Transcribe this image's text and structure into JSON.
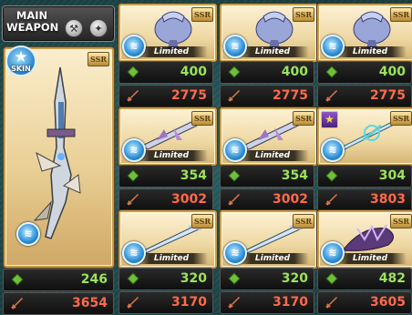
{
  "main": {
    "title_line1": "MAIN",
    "title_line2": "WEAPON",
    "skin_label": "SKIN",
    "rarity": "SSR",
    "hp": "246",
    "atk": "3654"
  },
  "grid": [
    {
      "rarity": "SSR",
      "limited": "Limited",
      "hp": "400",
      "atk": "2775"
    },
    {
      "rarity": "SSR",
      "limited": "Limited",
      "hp": "400",
      "atk": "2775"
    },
    {
      "rarity": "SSR",
      "limited": "Limited",
      "hp": "400",
      "atk": "2775"
    },
    {
      "rarity": "SSR",
      "limited": "Limited",
      "hp": "354",
      "atk": "3002"
    },
    {
      "rarity": "SSR",
      "limited": "Limited",
      "hp": "354",
      "atk": "3002"
    },
    {
      "rarity": "SSR",
      "limited": "",
      "hp": "304",
      "atk": "3803"
    },
    {
      "rarity": "SSR",
      "limited": "Limited",
      "hp": "320",
      "atk": "3170"
    },
    {
      "rarity": "SSR",
      "limited": "Limited",
      "hp": "320",
      "atk": "3170"
    },
    {
      "rarity": "SSR",
      "limited": "Limited",
      "hp": "482",
      "atk": "3605"
    }
  ],
  "colors": {
    "hp": "#9be35c",
    "atk": "#ff6a4a",
    "card_border": "#c99d4b"
  },
  "icons": [
    "hammer-icon",
    "wrench-icon",
    "star-icon",
    "wind-element-icon",
    "hp-diamond-icon",
    "attack-sword-icon"
  ]
}
